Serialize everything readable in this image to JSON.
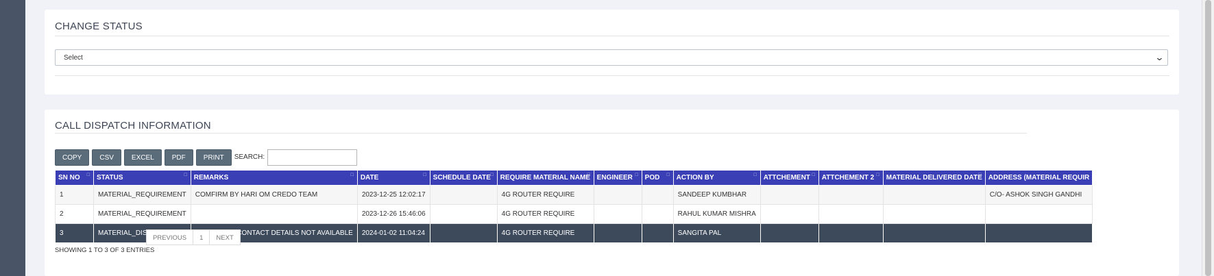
{
  "change_status": {
    "title": "CHANGE STATUS",
    "select_value": "Select"
  },
  "dispatch": {
    "title": "CALL DISPATCH INFORMATION",
    "buttons": [
      "COPY",
      "CSV",
      "EXCEL",
      "PDF",
      "PRINT"
    ],
    "search_label": "SEARCH:",
    "search_value": "",
    "columns": [
      "SN NO",
      "STATUS",
      "REMARKS",
      "DATE",
      "SCHEDULE DATE",
      "REQUIRE MATERIAL NAME",
      "ENGINEER",
      "POD",
      "ACTION BY",
      "ATTCHEMENT",
      "ATTCHEMENT 2",
      "MATERIAL DELIVERED DATE",
      "ADDRESS (MATERIAL REQUIR"
    ],
    "rows": [
      [
        "1",
        "MATERIAL_REQUIREMENT",
        "COMFIRM BY HARI OM CREDO TEAM",
        "2023-12-25 12:02:17",
        "",
        "4G ROUTER REQUIRE",
        "",
        "",
        "SANDEEP KUMBHAR",
        "",
        "",
        "",
        "C/O- ASHOK SINGH GANDHI"
      ],
      [
        "2",
        "MATERIAL_REQUIREMENT",
        "",
        "2023-12-26 15:46:06",
        "",
        "4G ROUTER REQUIRE",
        "",
        "",
        "RAHUL KUMAR MISHRA",
        "",
        "",
        "",
        ""
      ],
      [
        "3",
        "MATERIAL_DISPATCH",
        "ADDRESS & CONTACT DETAILS NOT AVAILABLE",
        "2024-01-02 11:04:24",
        "",
        "4G ROUTER REQUIRE",
        "",
        "",
        "SANGITA PAL",
        "",
        "",
        "",
        ""
      ]
    ],
    "info": "SHOWING 1 TO 3 OF 3 ENTRIES",
    "pager": {
      "previous": "PREVIOUS",
      "page": "1",
      "next": "NEXT"
    }
  },
  "colors": {
    "header_bg": "#3b3fb5",
    "selected_row": "#3d4a5c",
    "button_bg": "#5a6b7a",
    "rail": "#4a5467"
  }
}
